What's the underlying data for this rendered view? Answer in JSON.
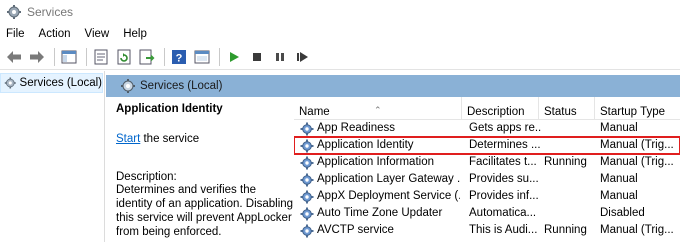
{
  "window": {
    "title": "Services"
  },
  "menu": [
    "File",
    "Action",
    "View",
    "Help"
  ],
  "toolbar": {
    "icons": [
      "back-arrow-icon",
      "forward-arrow-icon",
      "show-hide-console-tree-icon",
      "properties-icon",
      "refresh-icon",
      "export-list-icon",
      "help-icon",
      "console-view-icon",
      "start-icon",
      "stop-icon",
      "pause-icon",
      "restart-icon"
    ]
  },
  "tree": {
    "root_label": "Services (Local)"
  },
  "main": {
    "header_label": "Services (Local)",
    "detail": {
      "service_name": "Application Identity",
      "start_link": "Start",
      "start_suffix": " the service",
      "description_label": "Description:",
      "description": "Determines and verifies the identity of an application. Disabling this service will prevent AppLocker from being enforced."
    },
    "columns": {
      "name": "Name",
      "description": "Description",
      "status": "Status",
      "startup": "Startup Type"
    },
    "services": [
      {
        "name": "App Readiness",
        "description": "Gets apps re...",
        "status": "",
        "startup": "Manual"
      },
      {
        "name": "Application Identity",
        "description": "Determines ...",
        "status": "",
        "startup": "Manual (Trig..."
      },
      {
        "name": "Application Information",
        "description": "Facilitates t...",
        "status": "Running",
        "startup": "Manual (Trig..."
      },
      {
        "name": "Application Layer Gateway ...",
        "description": "Provides su...",
        "status": "",
        "startup": "Manual"
      },
      {
        "name": "AppX Deployment Service (...",
        "description": "Provides inf...",
        "status": "",
        "startup": "Manual"
      },
      {
        "name": "Auto Time Zone Updater",
        "description": "Automatica...",
        "status": "",
        "startup": "Disabled"
      },
      {
        "name": "AVCTP service",
        "description": "This is Audi...",
        "status": "Running",
        "startup": "Manual (Trig..."
      }
    ],
    "selected_service": "Application Identity"
  },
  "colors": {
    "header_bar": "#8ab1d6",
    "selection_outline": "#e01e1e",
    "link": "#0066cc",
    "play_green": "#2e9b2e"
  }
}
